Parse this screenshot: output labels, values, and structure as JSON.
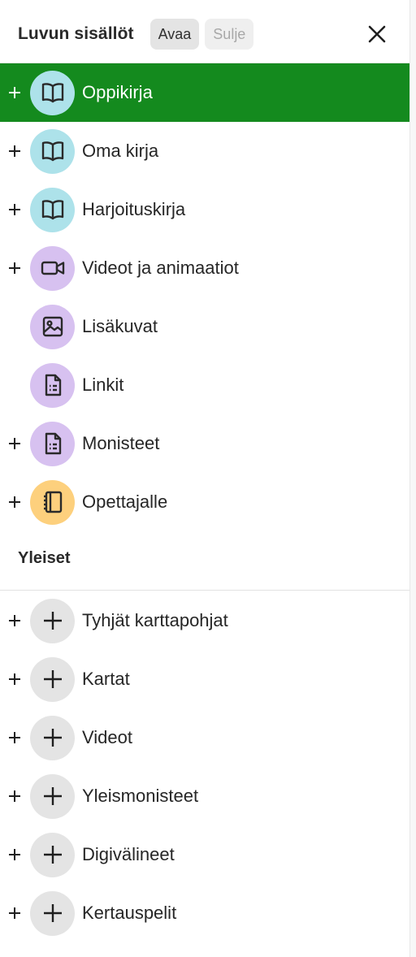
{
  "header": {
    "title": "Luvun sisällöt",
    "open_label": "Avaa",
    "close_label": "Sulje",
    "close_icon": "close-icon"
  },
  "chapter_items": [
    {
      "label": "Oppikirja",
      "icon": "book-icon",
      "color": "#ade2ea",
      "expandable": true,
      "selected": true
    },
    {
      "label": "Oma kirja",
      "icon": "book-icon",
      "color": "#ade2ea",
      "expandable": true,
      "selected": false
    },
    {
      "label": "Harjoituskirja",
      "icon": "book-icon",
      "color": "#ade2ea",
      "expandable": true,
      "selected": false
    },
    {
      "label": "Videot ja animaatiot",
      "icon": "video-camera-icon",
      "color": "#d7c1f0",
      "expandable": true,
      "selected": false
    },
    {
      "label": "Lisäkuvat",
      "icon": "image-icon",
      "color": "#d7c1f0",
      "expandable": false,
      "selected": false
    },
    {
      "label": "Linkit",
      "icon": "document-icon",
      "color": "#d7c1f0",
      "expandable": false,
      "selected": false
    },
    {
      "label": "Monisteet",
      "icon": "document-icon",
      "color": "#d7c1f0",
      "expandable": true,
      "selected": false
    },
    {
      "label": "Opettajalle",
      "icon": "notebook-icon",
      "color": "#fdd07d",
      "expandable": true,
      "selected": false
    }
  ],
  "general_section": {
    "title": "Yleiset",
    "items": [
      {
        "label": "Tyhjät karttapohjat",
        "icon": "plus-icon",
        "expandable": true
      },
      {
        "label": "Kartat",
        "icon": "plus-icon",
        "expandable": true
      },
      {
        "label": "Videot",
        "icon": "plus-icon",
        "expandable": true
      },
      {
        "label": "Yleismonisteet",
        "icon": "plus-icon",
        "expandable": true
      },
      {
        "label": "Digivälineet",
        "icon": "plus-icon",
        "expandable": true
      },
      {
        "label": "Kertauspelit",
        "icon": "plus-icon",
        "expandable": true
      }
    ]
  },
  "colors": {
    "selected_background": "#148a1e",
    "selected_text": "#ffffff"
  }
}
